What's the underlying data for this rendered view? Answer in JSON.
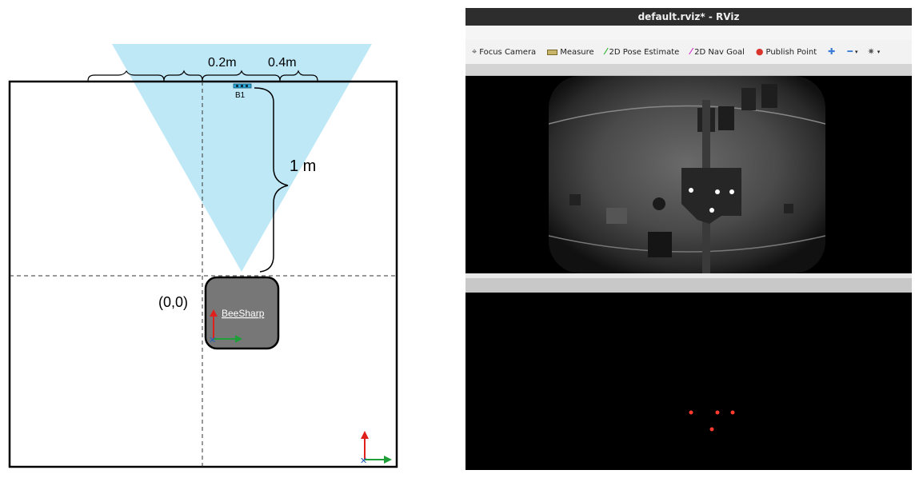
{
  "diagram": {
    "dim_small": "0.2m",
    "dim_large": "0.4m",
    "dim_range": "1 m",
    "beacon_label": "B1",
    "origin_label": "(0,0)",
    "robot_label": "BeeSharp",
    "colors": {
      "fov": "#bfe8f7",
      "robot": "#777777",
      "beacon": "#2aa7d8",
      "axis_x": "#1f9e3a",
      "axis_y": "#e0201c",
      "axis_z": "#1f5fb8"
    }
  },
  "rviz": {
    "title": "default.rviz* - RViz",
    "toolbar": {
      "focus_camera": "Focus Camera",
      "measure": "Measure",
      "pose_estimate": "2D Pose Estimate",
      "nav_goal": "2D Nav Goal",
      "publish_point": "Publish Point"
    },
    "icons": [
      "focus-camera-icon",
      "measure-icon",
      "pose-estimate-icon",
      "nav-goal-icon",
      "publish-point-icon",
      "move-icon",
      "zoom-icon",
      "view-icon"
    ]
  }
}
